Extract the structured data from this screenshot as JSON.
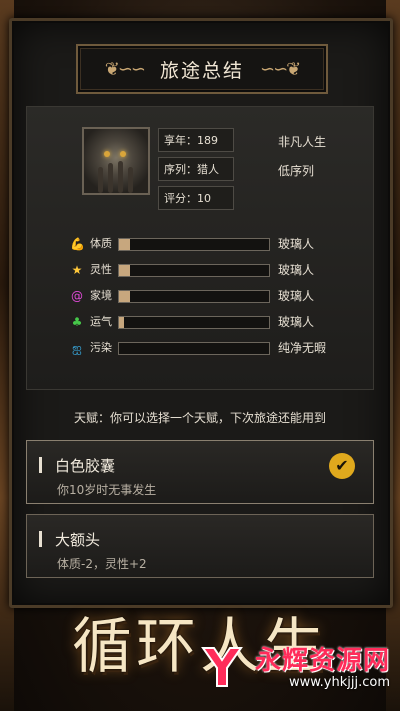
{
  "header": {
    "title": "旅途总结",
    "left_flourish": "❦∽∽",
    "right_flourish": "∽∽❦"
  },
  "character": {
    "age": "享年：189",
    "sequence": "序列：猎人",
    "score": "评分：10",
    "rank_label": "非凡人生",
    "sequence_tier": "低序列"
  },
  "attributes": [
    {
      "icon": "strength-icon",
      "label": "体质",
      "fill": 0.07,
      "value": "玻璃人",
      "color": "#ff6a3a",
      "glyph": "💪"
    },
    {
      "icon": "star-icon",
      "label": "灵性",
      "fill": 0.07,
      "value": "玻璃人",
      "color": "#ffc83a",
      "glyph": "★"
    },
    {
      "icon": "swirl-icon",
      "label": "家境",
      "fill": 0.07,
      "value": "玻璃人",
      "color": "#e04ad8",
      "glyph": "@"
    },
    {
      "icon": "clover-icon",
      "label": "运气",
      "fill": 0.03,
      "value": "玻璃人",
      "color": "#46c84a",
      "glyph": "♣"
    },
    {
      "icon": "pollution-icon",
      "label": "污染",
      "fill": 0.0,
      "value": "纯净无暇",
      "color": "#3ab0e8",
      "glyph": "ஐ"
    }
  ],
  "talent_hint": "天赋：你可以选择一个天赋，下次旅途还能用到",
  "talents": [
    {
      "name": "白色胶囊",
      "desc": "你10岁时无事发生",
      "selected": true,
      "check": "✔"
    },
    {
      "name": "大额头",
      "desc": "体质-2，灵性+2",
      "selected": false
    }
  ],
  "game_title": "循环人生",
  "watermark": {
    "name": "永辉资源网",
    "url": "www.yhkjjj.com"
  }
}
